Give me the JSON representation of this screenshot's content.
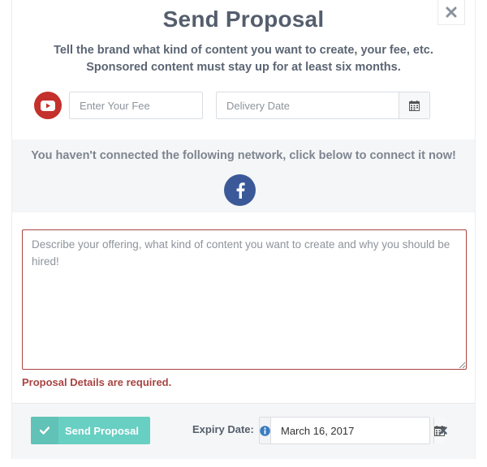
{
  "modal": {
    "title": "Send Proposal",
    "subtitle_line1": "Tell the brand what kind of content you want to create, your fee, etc.",
    "subtitle_line2": "Sponsored content must stay up for at least six months."
  },
  "form": {
    "fee_placeholder": "Enter Your Fee",
    "delivery_placeholder": "Delivery Date",
    "network_icon": "youtube-icon"
  },
  "connect": {
    "message": "You haven't connected the following network, click below to connect it now!",
    "network_icon": "facebook-icon"
  },
  "details": {
    "placeholder": "Describe your offering, what kind of content you want to create and why you should be hired!",
    "error": "Proposal Details are required."
  },
  "footer": {
    "send_label": "Send Proposal",
    "expiry_label": "Expiry Date:",
    "expiry_value": "March 16, 2017"
  },
  "colors": {
    "youtube": "#c4302b",
    "facebook": "#3b5998",
    "send_button": "#68cfc3",
    "error": "#a94442"
  }
}
